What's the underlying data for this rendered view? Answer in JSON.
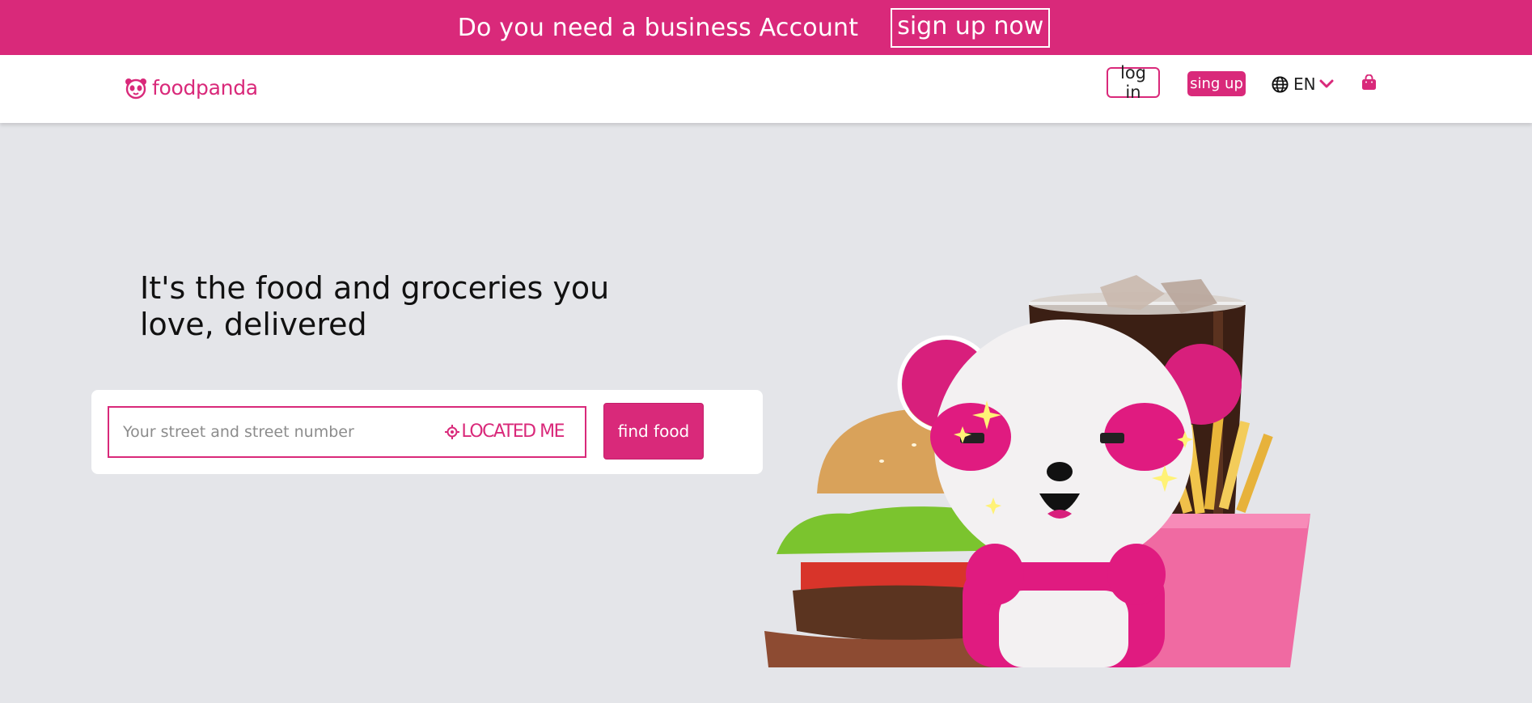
{
  "promo": {
    "text": "Do you need a business Account",
    "button_label": "sign up now"
  },
  "header": {
    "brand": "foodpanda",
    "login_label": "log in",
    "signup_label": "sing up",
    "language": "EN",
    "icons": {
      "language": "globe-icon",
      "chevron": "chevron-down-icon",
      "cart": "shopping-bag-icon",
      "brand": "panda-logo-icon"
    }
  },
  "hero": {
    "headline": "It's the food and groceries you love, delivered",
    "search": {
      "placeholder": "Your street and street number",
      "value": "",
      "locate_label": "LOCATED ME",
      "locate_icon": "crosshair-icon"
    },
    "find_label": "find food"
  },
  "colors": {
    "brand": "#d9297a",
    "background": "#e4e5e9",
    "header_bg": "#ffffff"
  }
}
